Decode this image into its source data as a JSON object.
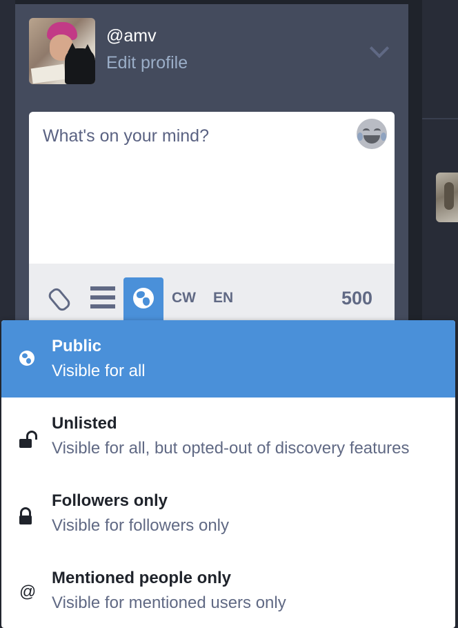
{
  "profile": {
    "username": "@amv",
    "edit_label": "Edit profile"
  },
  "compose": {
    "placeholder": "What's on your mind?",
    "cw_label": "CW",
    "language_label": "EN",
    "char_counter": "500"
  },
  "privacy_menu": {
    "selected": "public",
    "options": [
      {
        "title": "Public",
        "description": "Visible for all",
        "icon": "globe-icon"
      },
      {
        "title": "Unlisted",
        "description": "Visible for all, but opted-out of discovery features",
        "icon": "unlock-icon"
      },
      {
        "title": "Followers only",
        "description": "Visible for followers only",
        "icon": "lock-icon"
      },
      {
        "title": "Mentioned people only",
        "description": "Visible for mentioned users only",
        "icon": "at-icon"
      }
    ]
  },
  "colors": {
    "accent": "#4a90d9",
    "panel": "#444b5d",
    "background": "#1f232b",
    "muted_text": "#606984",
    "link_text": "#9baec8"
  }
}
